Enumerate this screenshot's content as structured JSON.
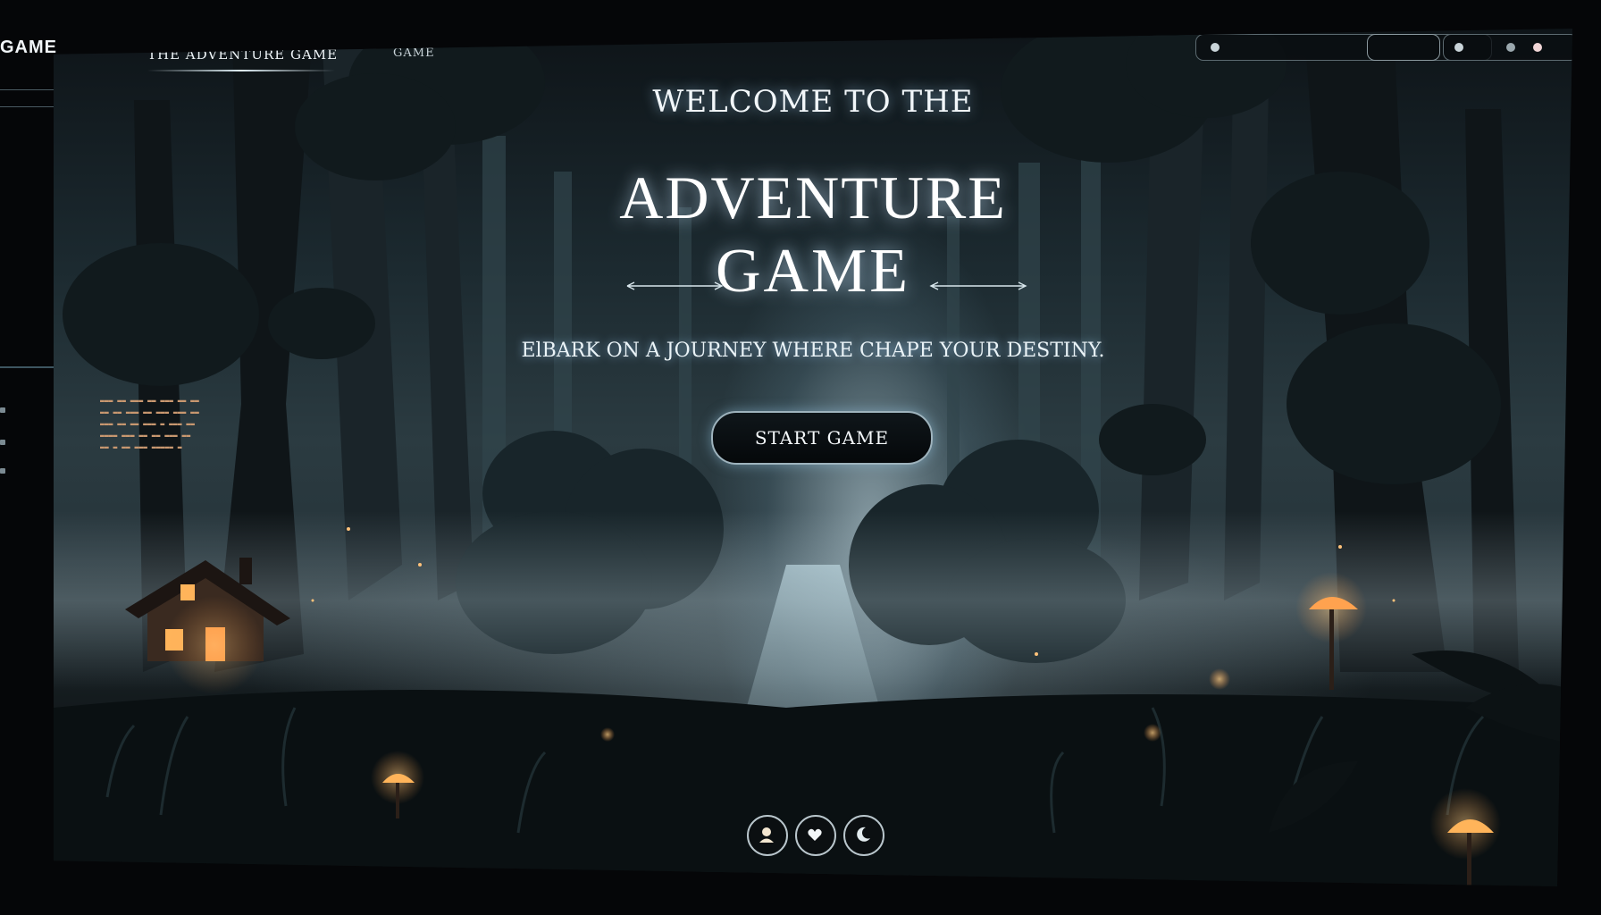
{
  "sidebar": {
    "brand": "GAME",
    "items": [
      "",
      "",
      "",
      "",
      "",
      ""
    ]
  },
  "nav": {
    "title": "THE ADVENTURE GAME",
    "game_link": "GAME",
    "other_link": ""
  },
  "top_right": {
    "pill_1_text": "",
    "pill_2_text": "",
    "pill_3_text": ""
  },
  "hero": {
    "welcome": "WELCOME TO THE",
    "title_line_1": "ADVENTURE",
    "title_line_2": "GAME",
    "tagline": "ElBARK ON A JOURNEY WHERE CHAPE YOUR DESTINY.",
    "start_button": "START GAME"
  },
  "bottom_buttons": [
    "character-icon",
    "hand-heart-icon",
    "moon-icon"
  ],
  "colors": {
    "accent_glow": "#bfe3ff",
    "lantern": "#ffb45a",
    "mushroom_glow": "#ff9c48",
    "panel_dark": "#0a0d0e"
  }
}
